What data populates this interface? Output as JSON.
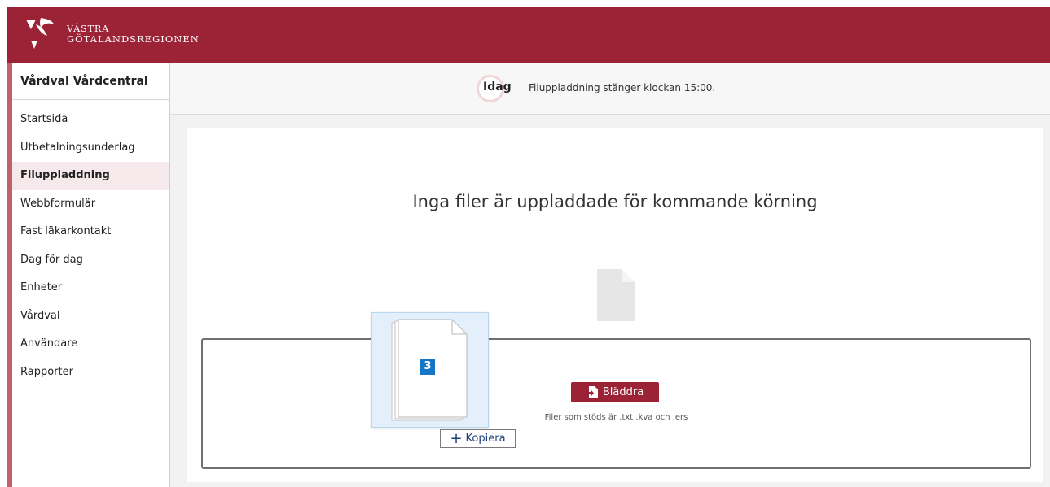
{
  "header": {
    "logo_line1": "VÄSTRA",
    "logo_line2": "GÖTALANDSREGIONEN",
    "brand_color": "#9b2335"
  },
  "sidebar": {
    "title": "Vårdval Vårdcentral",
    "items": [
      {
        "label": "Startsida"
      },
      {
        "label": "Utbetalningsunderlag"
      },
      {
        "label": "Filuppladdning",
        "active": true
      },
      {
        "label": "Webbformulär"
      },
      {
        "label": "Fast läkarkontakt"
      },
      {
        "label": "Dag för dag"
      },
      {
        "label": "Enheter"
      },
      {
        "label": "Vårdval"
      },
      {
        "label": "Användare"
      },
      {
        "label": "Rapporter"
      }
    ]
  },
  "notice": {
    "label": "Idag",
    "text": "Filuppladdning stänger klockan 15:00."
  },
  "main": {
    "heading": "Inga filer är uppladdade för kommande körning",
    "file_icon": "document-icon",
    "browse_label": "Bläddra",
    "browse_icon": "file-import-icon",
    "supported_text": "Filer som stöds är .txt .kva och .ers"
  },
  "drag": {
    "count": "3",
    "copy_label": "Kopiera",
    "copy_icon": "plus-icon"
  }
}
